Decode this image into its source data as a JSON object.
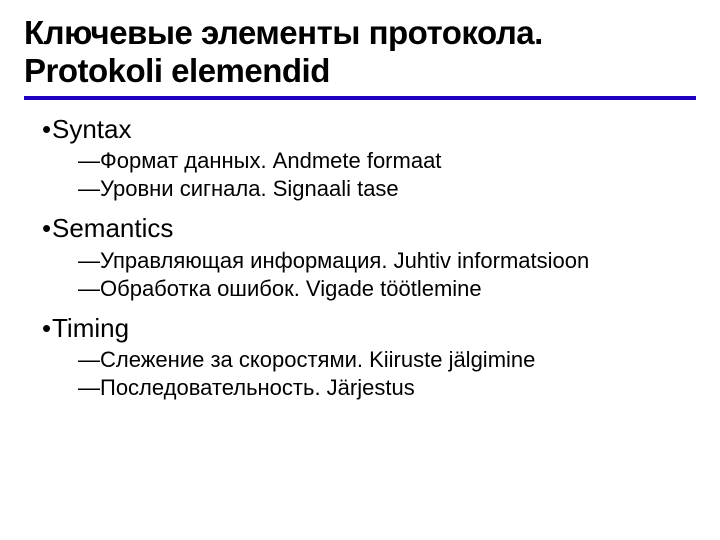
{
  "title_line1": "Ключевые элементы протокола.",
  "title_line2": "Protokoli elemendid",
  "sections": [
    {
      "label": "Syntax",
      "items": [
        "Формат данных. Andmete formaat",
        "Уровни сигнала. Signaali tase"
      ]
    },
    {
      "label": "Semantics",
      "items": [
        "Управляющая информация. Juhtiv informatsioon",
        "Обработка ошибок. Vigade töötlemine"
      ]
    },
    {
      "label": "Timing",
      "items": [
        "Слежение за скоростями. Kiiruste jälgimine",
        "Последовательность. Järjestus"
      ]
    }
  ],
  "glyphs": {
    "bullet": "•",
    "dash": "—"
  }
}
